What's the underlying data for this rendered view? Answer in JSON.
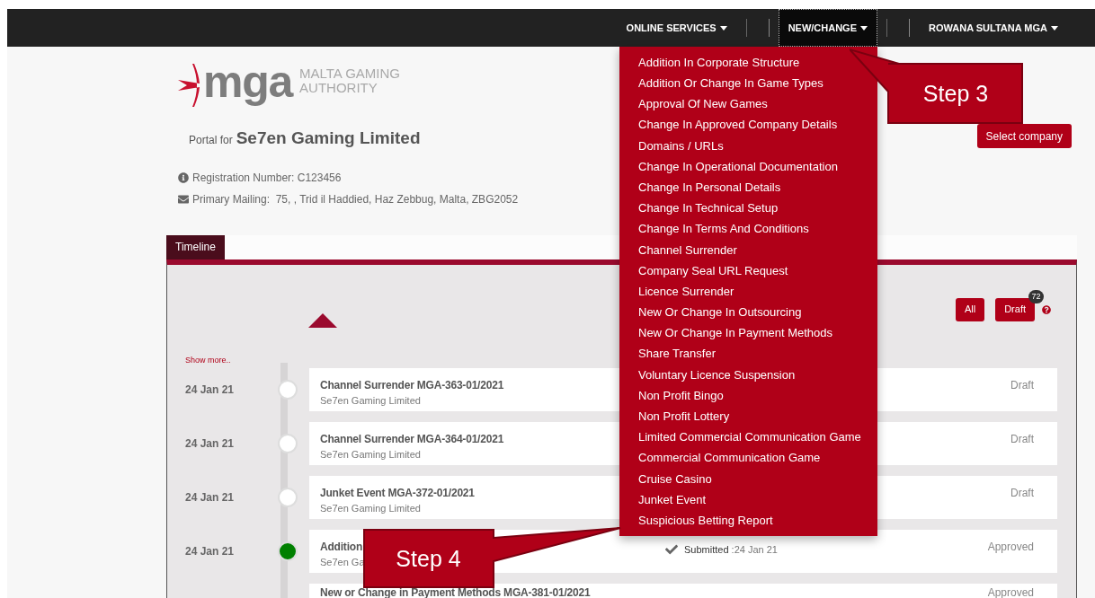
{
  "navbar": {
    "items": [
      {
        "label": "ONLINE SERVICES",
        "selected": false
      },
      {
        "label": "NEW/CHANGE",
        "selected": true
      },
      {
        "label": "ROWANA SULTANA MGA",
        "selected": false
      }
    ]
  },
  "logo": {
    "wordmark": "mga",
    "line1": "MALTA GAMING",
    "line2": "AUTHORITY"
  },
  "portal": {
    "prefix": "Portal for",
    "company": "Se7en Gaming Limited"
  },
  "registration": "Registration Number: C123456",
  "mailing": "Primary Mailing:  75, , Trid il Haddied, Haz Zebbug, Malta, ZBG2052",
  "select_company_button": "Select company",
  "dropdown": {
    "items": [
      "Addition In Corporate Structure",
      "Addition Or Change In Game Types",
      "Approval Of New Games",
      "Change In Approved Company Details",
      "Domains / URLs",
      "Change In Operational Documentation",
      "Change In Personal Details",
      "Change In Technical Setup",
      "Change In Terms And Conditions",
      "Channel Surrender",
      "Company Seal URL Request",
      "Licence Surrender",
      "New Or Change In Outsourcing",
      "New Or Change In Payment Methods",
      "Share Transfer",
      "Voluntary Licence Suspension",
      "Non Profit Bingo",
      "Non Profit Lottery",
      "Limited Commercial Communication Game",
      "Commercial Communication Game",
      "Cruise Casino",
      "Junket Event",
      "Suspicious Betting Report"
    ]
  },
  "tabs": [
    {
      "label": "Timeline",
      "selected": true
    }
  ],
  "filters": [
    {
      "label": "All"
    },
    {
      "label": "Draft",
      "badge": "72"
    }
  ],
  "show_more": "Show more..",
  "rows": [
    {
      "date": "24 Jan 21",
      "title": "Channel Surrender MGA-363-01/2021",
      "subtitle": "Se7en Gaming Limited",
      "status": "Draft",
      "completed": false
    },
    {
      "date": "24 Jan 21",
      "title": "Channel Surrender MGA-364-01/2021",
      "subtitle": "Se7en Gaming Limited",
      "status": "Draft",
      "completed": false
    },
    {
      "date": "24 Jan 21",
      "title": "Junket Event MGA-372-01/2021",
      "subtitle": "Se7en Gaming Limited",
      "status": "Draft",
      "completed": false
    },
    {
      "date": "24 Jan 21",
      "title": "Addition",
      "subtitle": "Se7en Ga",
      "status": "Approved",
      "completed": true,
      "submitted_label": "Submitted",
      "submitted_date": " :24 Jan 21"
    },
    {
      "title": "New or Change in Payment Methods MGA-381-01/2021",
      "status": "Approved"
    }
  ],
  "callouts": [
    {
      "label": "Step 3",
      "kind": "up"
    },
    {
      "label": "Step 4",
      "kind": "right"
    }
  ]
}
